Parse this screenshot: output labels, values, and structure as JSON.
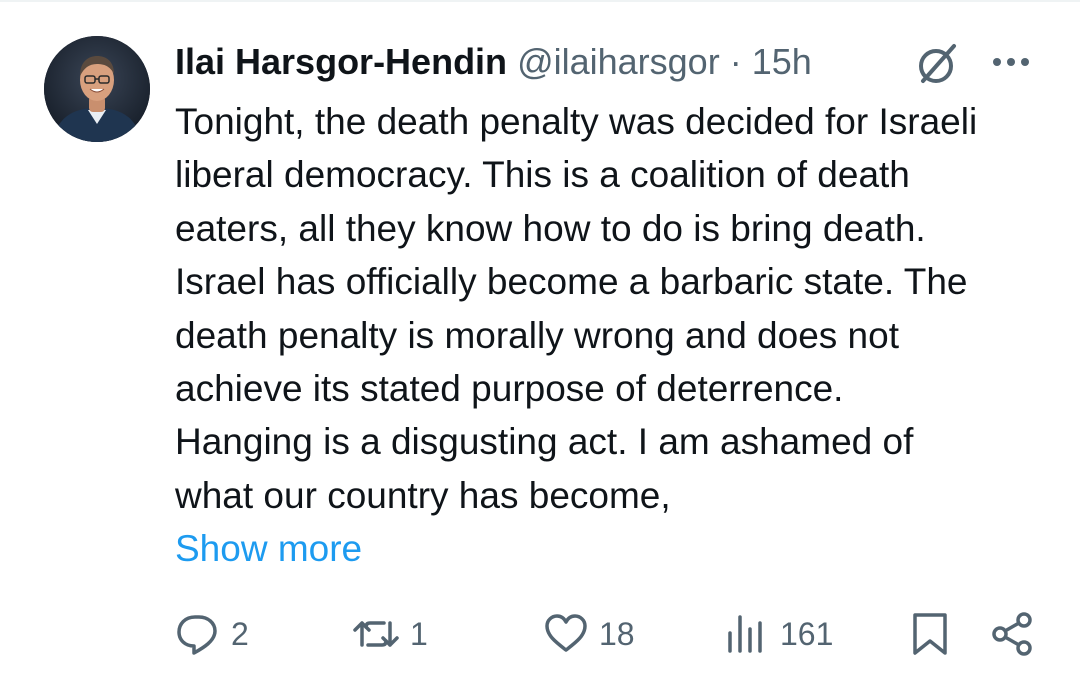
{
  "tweet": {
    "author": {
      "name": "Ilai Harsgor-Hendin",
      "handle": "@ilaiharsgor",
      "avatar_icon": "avatar-photo"
    },
    "separator": "·",
    "time": "15h",
    "header_icons": [
      "grok-icon",
      "more-dots-icon"
    ],
    "lines": [
      "Tonight, the death penalty was decided for Israeli",
      "liberal democracy. This is a coalition of death",
      "eaters, all they know how to do is bring death.",
      "Israel has officially become a barbaric state. The",
      "death penalty is morally wrong and does not",
      "achieve its stated purpose of deterrence.",
      "Hanging is a disgusting act. I am ashamed of",
      "what our country has become,"
    ],
    "show_more_label": "Show more",
    "actions": {
      "reply_count": "2",
      "repost_count": "1",
      "like_count": "18",
      "views_count": "161"
    },
    "colors": {
      "text": "#0f1419",
      "secondary": "#536471",
      "link": "#1d9bf0",
      "background": "#ffffff"
    }
  }
}
